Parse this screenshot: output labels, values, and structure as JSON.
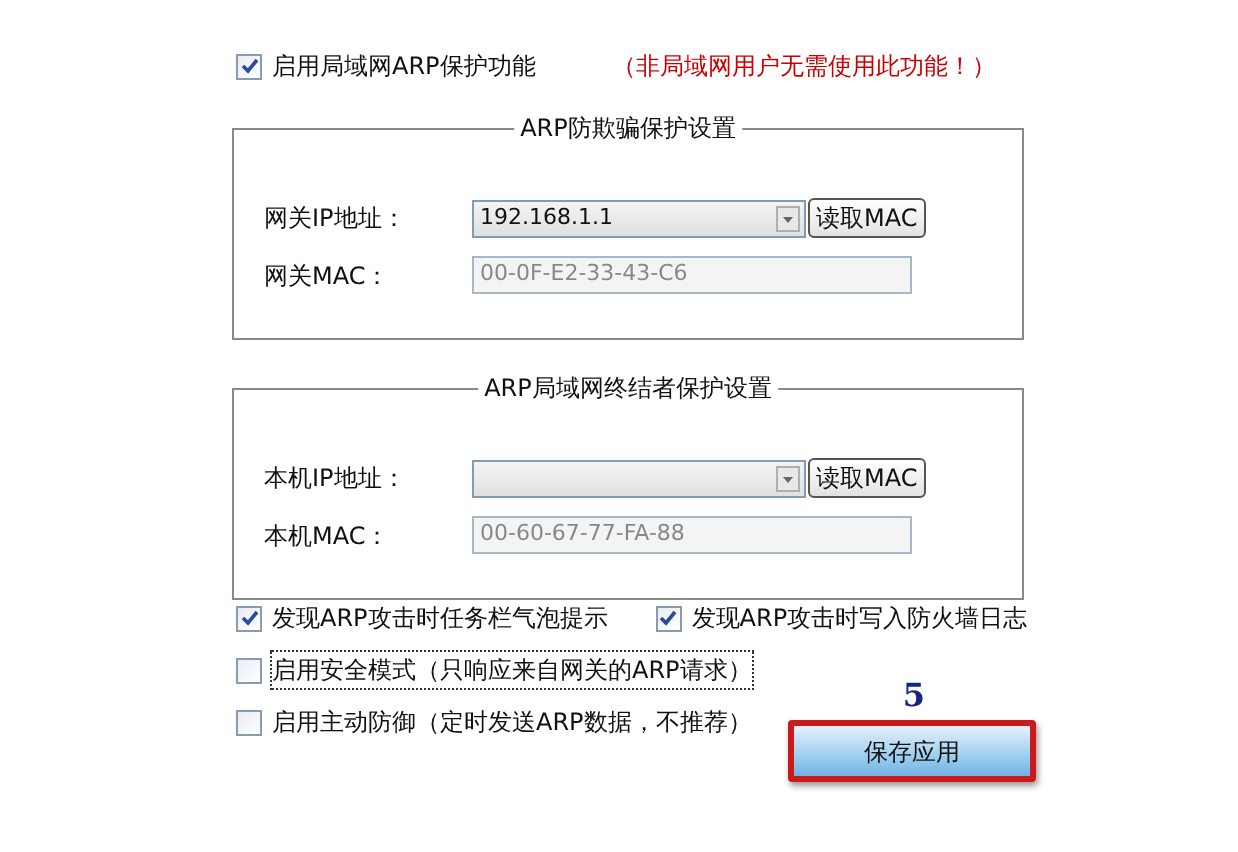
{
  "enable_arp": {
    "label": "启用局域网ARP保护功能",
    "checked": true
  },
  "note": "（非局域网用户无需使用此功能！）",
  "groups": [
    {
      "title": "ARP防欺骗保护设置",
      "ip_label": "网关IP地址：",
      "ip_value": "192.168.1.1",
      "read_button": "读取MAC",
      "mac_label": "网关MAC：",
      "mac_value": "00-0F-E2-33-43-C6"
    },
    {
      "title": "ARP局域网终结者保护设置",
      "ip_label": "本机IP地址：",
      "read_button": "读取MAC",
      "mac_label": "本机MAC：",
      "mac_value": "00-60-67-77-FA-88"
    }
  ],
  "option_rows": [
    [
      {
        "label": "发现ARP攻击时任务栏气泡提示",
        "checked": true
      },
      {
        "label": "发现ARP攻击时写入防火墙日志",
        "checked": true
      }
    ],
    [
      {
        "label": "启用安全模式（只响应来自网关的ARP请求）",
        "checked": false,
        "focused": true
      }
    ],
    [
      {
        "label": "启用主动防御（定时发送ARP数据，不推荐）",
        "checked": false
      }
    ]
  ],
  "step_number": "5",
  "save_button": "保存应用"
}
